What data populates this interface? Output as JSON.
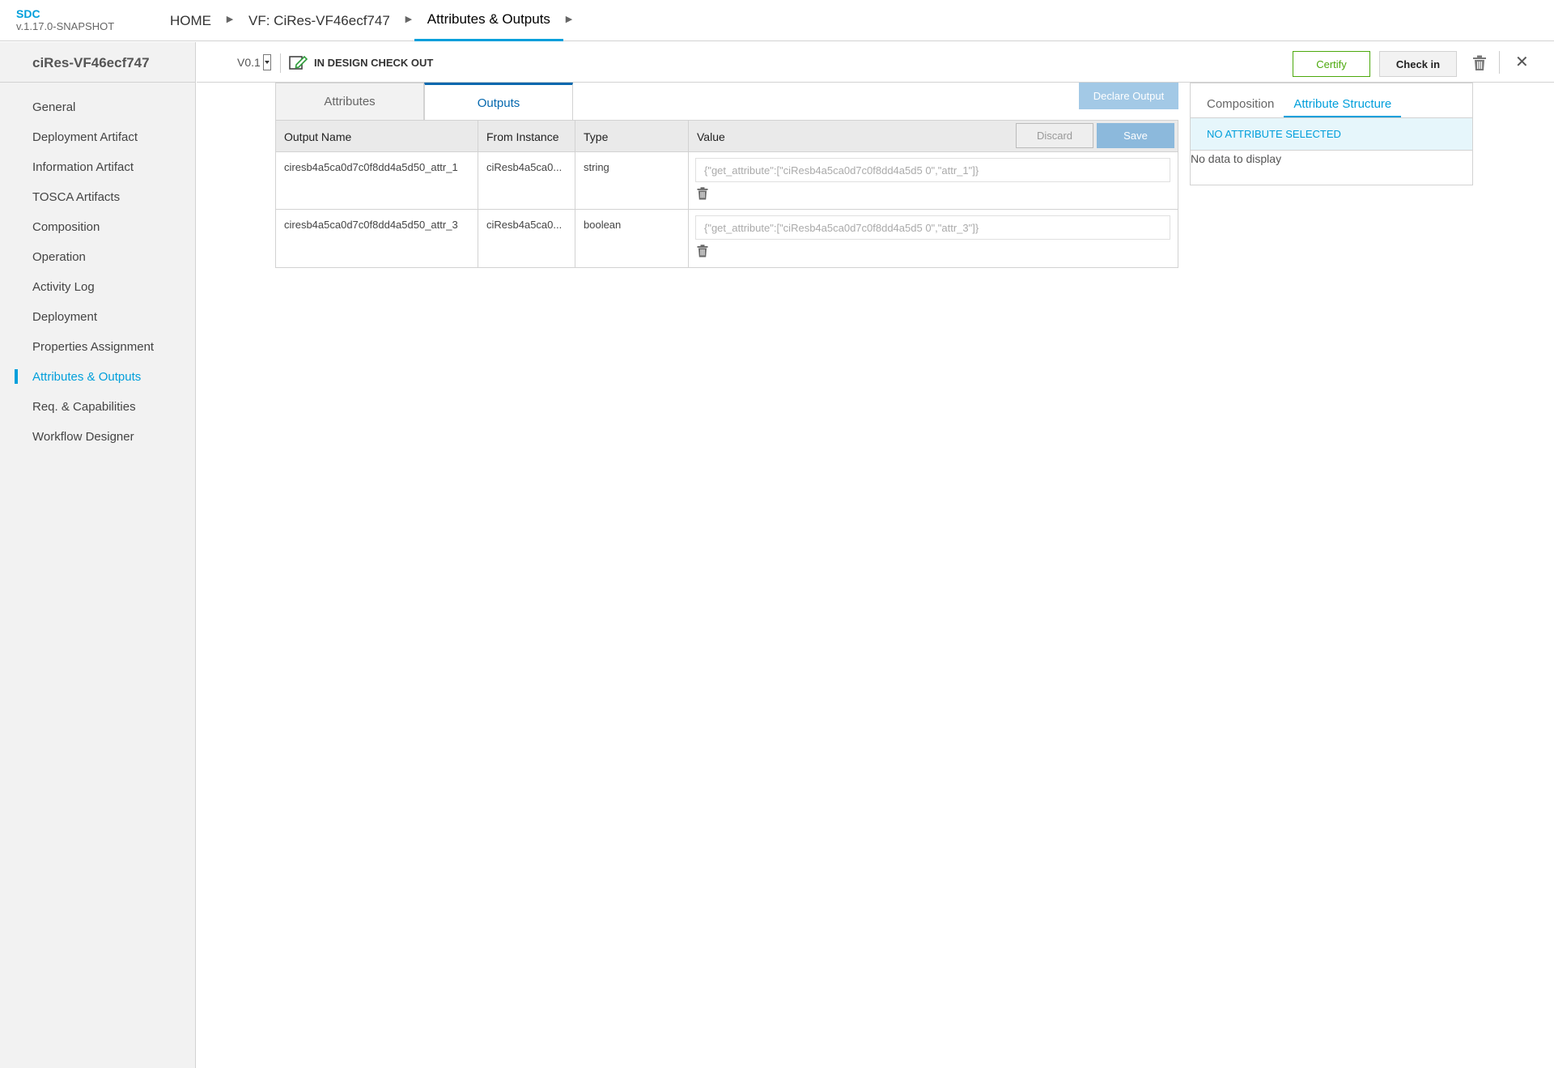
{
  "header": {
    "brand_name": "SDC",
    "brand_version": "v.1.17.0-SNAPSHOT",
    "breadcrumbs": [
      "HOME",
      "VF: CiRes-VF46ecf747",
      "Attributes & Outputs"
    ]
  },
  "sidebar": {
    "title": "ciRes-VF46ecf747",
    "items": [
      {
        "label": "General"
      },
      {
        "label": "Deployment Artifact"
      },
      {
        "label": "Information Artifact"
      },
      {
        "label": "TOSCA Artifacts"
      },
      {
        "label": "Composition"
      },
      {
        "label": "Operation"
      },
      {
        "label": "Activity Log"
      },
      {
        "label": "Deployment"
      },
      {
        "label": "Properties Assignment"
      },
      {
        "label": "Attributes & Outputs",
        "active": true
      },
      {
        "label": "Req. & Capabilities"
      },
      {
        "label": "Workflow Designer"
      }
    ]
  },
  "subheader": {
    "version": "V0.1",
    "status": "IN DESIGN CHECK OUT",
    "certify_label": "Certify",
    "checkin_label": "Check in"
  },
  "tabs": [
    {
      "label": "Attributes"
    },
    {
      "label": "Outputs",
      "active": true
    }
  ],
  "declare_output_label": "Declare Output",
  "table": {
    "headers": [
      "Output Name",
      "From Instance",
      "Type",
      "Value"
    ],
    "discard_label": "Discard",
    "save_label": "Save",
    "rows": [
      {
        "name": "ciresb4a5ca0d7c0f8dd4a5d50_attr_1",
        "instance": "ciResb4a5ca0...",
        "type": "string",
        "value": "{\"get_attribute\":[\"ciResb4a5ca0d7c0f8dd4a5d5 0\",\"attr_1\"]}"
      },
      {
        "name": "ciresb4a5ca0d7c0f8dd4a5d50_attr_3",
        "instance": "ciResb4a5ca0...",
        "type": "boolean",
        "value": "{\"get_attribute\":[\"ciResb4a5ca0d7c0f8dd4a5d5 0\",\"attr_3\"]}"
      }
    ]
  },
  "right_panel": {
    "tabs": [
      {
        "label": "Composition"
      },
      {
        "label": "Attribute Structure",
        "active": true
      }
    ],
    "no_selection": "NO ATTRIBUTE SELECTED",
    "no_data": "No data to display"
  },
  "colors": {
    "accent": "#009fdb",
    "tab_active": "#0568ae",
    "certify": "#4ca90c"
  },
  "icons": [
    "trash-icon",
    "close-icon",
    "edit-checkout-icon",
    "chevron-right-icon",
    "dropdown-caret-icon"
  ]
}
